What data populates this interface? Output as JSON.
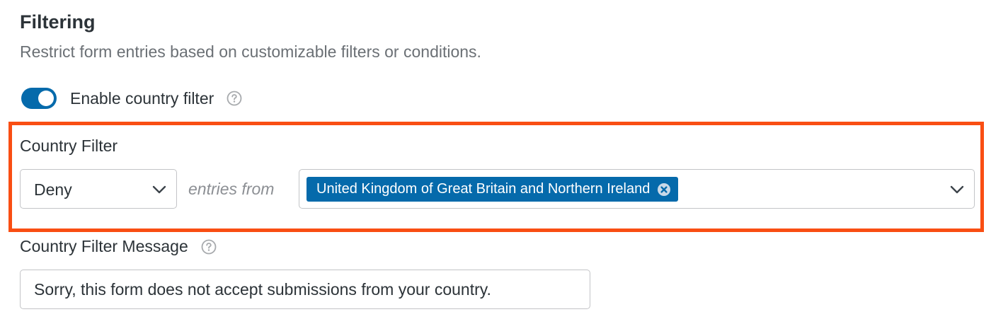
{
  "section": {
    "title": "Filtering",
    "description": "Restrict form entries based on customizable filters or conditions."
  },
  "country_filter_toggle": {
    "label": "Enable country filter",
    "enabled": true,
    "help_icon": "question-circle-icon"
  },
  "country_filter": {
    "label": "Country Filter",
    "mode_selected": "Deny",
    "mode_icon": "chevron-down-icon",
    "connector_text": "entries from",
    "countries_selected": [
      "United Kingdom of Great Britain and Northern Ireland"
    ],
    "tag_remove_icon": "close-circle-icon",
    "countries_icon": "chevron-down-icon"
  },
  "country_filter_message": {
    "label": "Country Filter Message",
    "help_icon": "question-circle-icon",
    "value": "Sorry, this form does not accept submissions from your country."
  },
  "colors": {
    "accent": "#056aab",
    "highlight": "#f94e13",
    "muted_text": "#6b7075",
    "border": "#c3c4c7"
  }
}
